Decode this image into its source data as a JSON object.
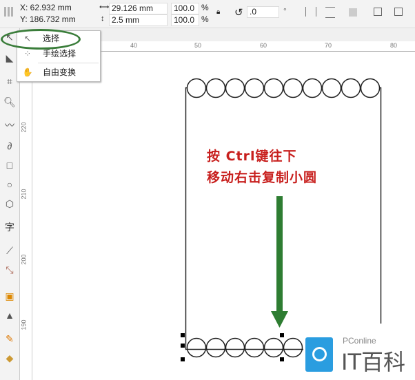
{
  "props": {
    "x": "X: 62.932 mm",
    "y": "Y: 186.732 mm",
    "width": "29.126 mm",
    "height": "2.5 mm",
    "scale_x": "100.0",
    "scale_y": "100.0",
    "pct": "%",
    "angle": ".0",
    "deg": "°"
  },
  "flyout": {
    "items": [
      {
        "label": "选择"
      },
      {
        "label": "手绘选择"
      },
      {
        "label": "自由变换"
      }
    ]
  },
  "hruler": [
    "40",
    "50",
    "60",
    "70",
    "80"
  ],
  "vruler": [
    "220",
    "210",
    "200",
    "190"
  ],
  "tools": {
    "text": "字"
  },
  "annotation": {
    "line1": "按 Ctrl键往下",
    "line2": "移动右击复制小圆"
  },
  "logo": {
    "brand": "PConline",
    "name": "IT百科"
  },
  "colors": {
    "arrow": "#2e7d32",
    "text": "#c8201e",
    "highlight": "#3a7d3a",
    "logo": "#2a9de0"
  }
}
